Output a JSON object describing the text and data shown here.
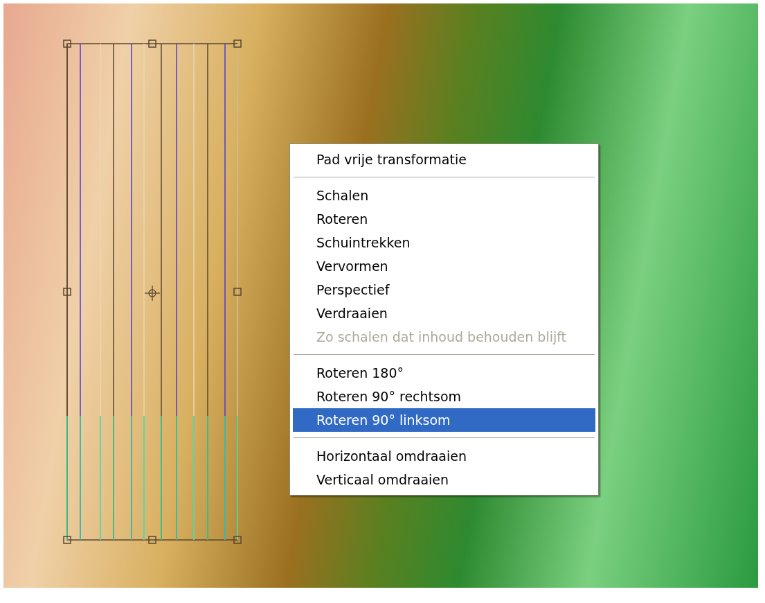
{
  "context_menu": {
    "items": [
      {
        "kind": "item",
        "label": "Pad vrije transformatie",
        "disabled": false,
        "selected": false
      },
      {
        "kind": "separator"
      },
      {
        "kind": "item",
        "label": "Schalen",
        "disabled": false,
        "selected": false
      },
      {
        "kind": "item",
        "label": "Roteren",
        "disabled": false,
        "selected": false
      },
      {
        "kind": "item",
        "label": "Schuintrekken",
        "disabled": false,
        "selected": false
      },
      {
        "kind": "item",
        "label": "Vervormen",
        "disabled": false,
        "selected": false
      },
      {
        "kind": "item",
        "label": "Perspectief",
        "disabled": false,
        "selected": false
      },
      {
        "kind": "item",
        "label": "Verdraaien",
        "disabled": false,
        "selected": false
      },
      {
        "kind": "item",
        "label": "Zo schalen dat inhoud behouden blijft",
        "disabled": true,
        "selected": false
      },
      {
        "kind": "separator"
      },
      {
        "kind": "item",
        "label": "Roteren 180°",
        "disabled": false,
        "selected": false
      },
      {
        "kind": "item",
        "label": "Roteren 90° rechtsom",
        "disabled": false,
        "selected": false
      },
      {
        "kind": "item",
        "label": "Roteren 90° linksom",
        "disabled": false,
        "selected": true
      },
      {
        "kind": "separator"
      },
      {
        "kind": "item",
        "label": "Horizontaal omdraaien",
        "disabled": false,
        "selected": false
      },
      {
        "kind": "item",
        "label": "Verticaal omdraaien",
        "disabled": false,
        "selected": false
      }
    ]
  }
}
